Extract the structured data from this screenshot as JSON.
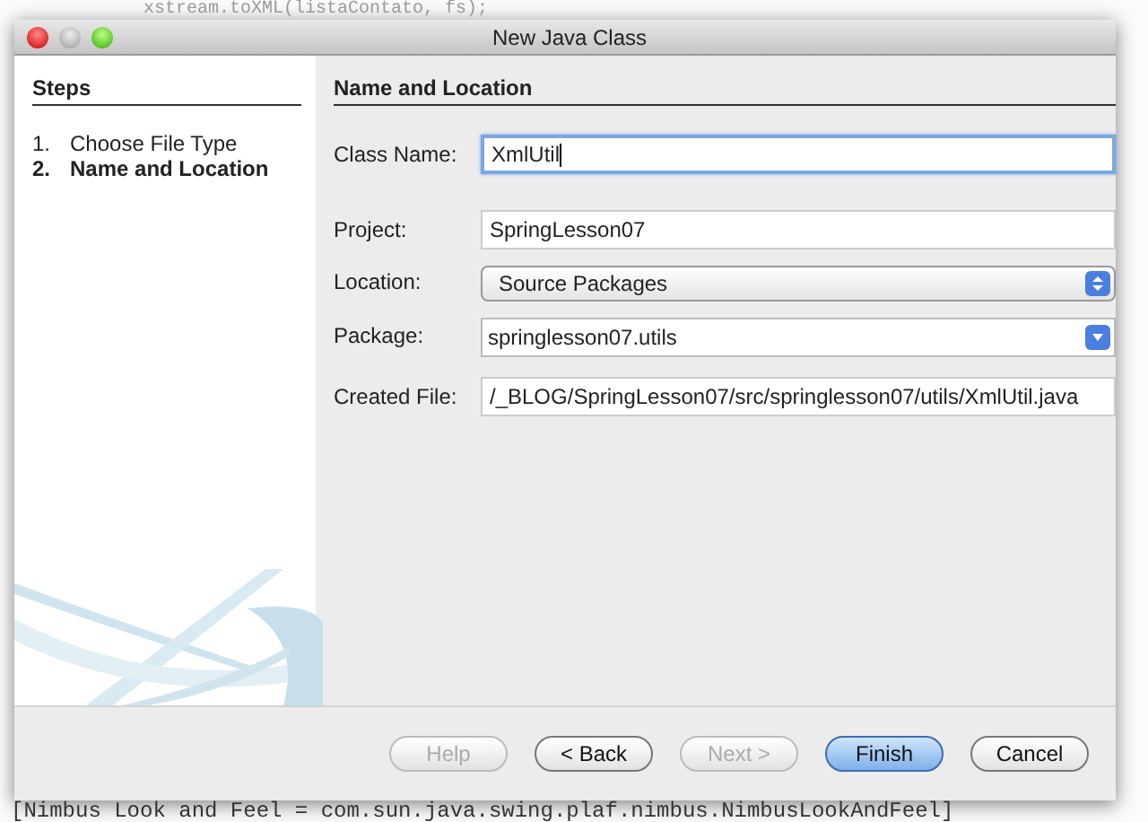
{
  "background_code": {
    "top_line": "xstream.toXML(listaContato, fs);",
    "bottom_line": "[Nimbus Look and Feel = com.sun.java.swing.plaf.nimbus.NimbusLookAndFeel]"
  },
  "window": {
    "title": "New Java Class"
  },
  "steps": {
    "heading": "Steps",
    "items": [
      {
        "number": "1.",
        "label": "Choose File Type",
        "selected": false
      },
      {
        "number": "2.",
        "label": "Name and Location",
        "selected": true
      }
    ]
  },
  "panel": {
    "heading": "Name and Location",
    "fields": [
      {
        "kind": "text",
        "label": "Class Name:",
        "value": "XmlUtil",
        "focused": true
      },
      {
        "kind": "text",
        "label": "Project:",
        "value": "SpringLesson07",
        "focused": false
      },
      {
        "kind": "select",
        "label": "Location:",
        "value": "Source Packages"
      },
      {
        "kind": "combo",
        "label": "Package:",
        "value": "springlesson07.utils"
      },
      {
        "kind": "text",
        "label": "Created File:",
        "value": "/_BLOG/SpringLesson07/src/springlesson07/utils/XmlUtil.java",
        "focused": false
      }
    ]
  },
  "buttons": [
    {
      "label": "Help",
      "disabled": true,
      "default": false
    },
    {
      "label": "< Back",
      "disabled": false,
      "default": false
    },
    {
      "label": "Next >",
      "disabled": true,
      "default": false
    },
    {
      "label": "Finish",
      "disabled": false,
      "default": true
    },
    {
      "label": "Cancel",
      "disabled": false,
      "default": false
    }
  ]
}
